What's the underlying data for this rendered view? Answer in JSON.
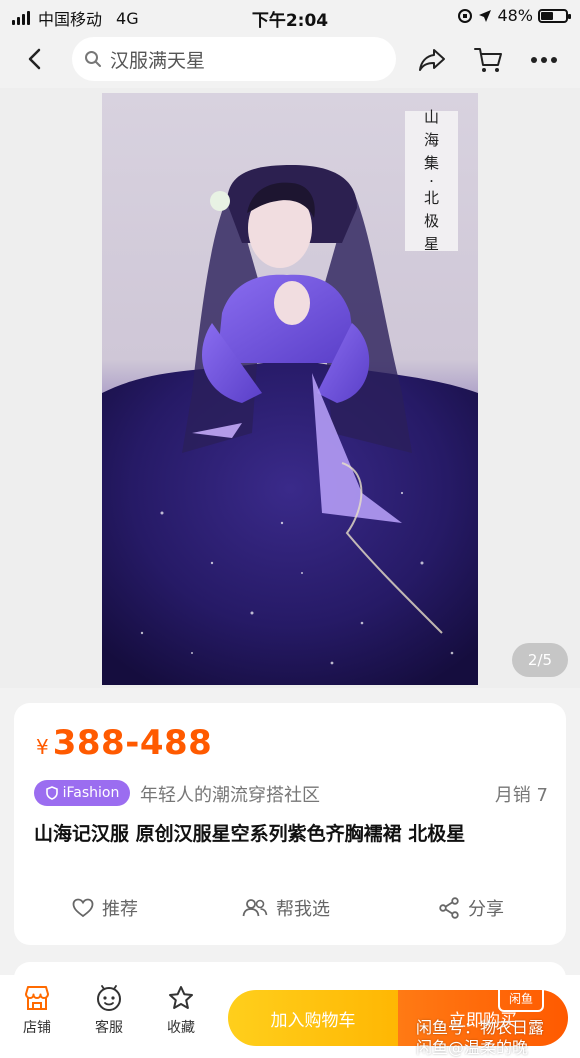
{
  "status_bar": {
    "carrier": "中国移动",
    "network": "4G",
    "time": "下午2:04",
    "battery_percent": "48%",
    "battery_level": 0.48
  },
  "nav": {
    "search_text": "汉服满天星"
  },
  "gallery": {
    "photo_title_chars": [
      "山",
      "海",
      "集",
      "·",
      "北",
      "极",
      "星"
    ],
    "page_indicator": "2/5"
  },
  "product": {
    "currency": "¥",
    "price": "388-488",
    "badge_label": "iFashion",
    "tagline": "年轻人的潮流穿搭社区",
    "monthly_sales": "月销 7",
    "title": "山海记汉服 原创汉服星空系列紫色齐胸襦裙 北极星",
    "actions": {
      "recommend": "推荐",
      "help_choose": "帮我选",
      "share": "分享"
    }
  },
  "bottom_bar": {
    "store": "店铺",
    "service": "客服",
    "favorite": "收藏",
    "add_to_cart": "加入购物车",
    "buy_now": "立即购买"
  },
  "watermark": {
    "logo": "闲鱼",
    "line1": "闲鱼号：物农日露",
    "line2": "闲鱼@温柔的晚"
  },
  "colors": {
    "accent": "#ff5a00",
    "cart_button": "#ffc107",
    "badge": "#9b6df0"
  }
}
